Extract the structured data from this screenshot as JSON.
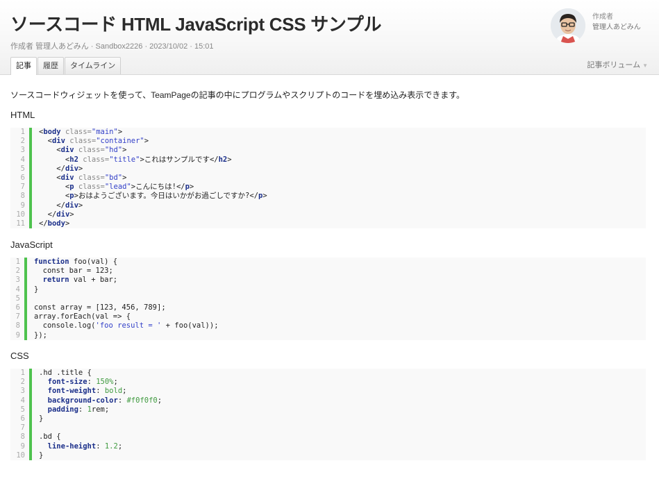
{
  "page": {
    "title": "ソースコード HTML JavaScript CSS サンプル",
    "meta": "作成者 管理人あどみん · Sandbox2226 · 2023/10/02 · 15:01",
    "author_label": "作成者",
    "author_name": "管理人あどみん",
    "tabs": [
      {
        "label": "記事",
        "active": true
      },
      {
        "label": "履歴",
        "active": false
      },
      {
        "label": "タイムライン",
        "active": false
      }
    ],
    "volume_menu": "記事ボリューム"
  },
  "content": {
    "intro": "ソースコードウィジェットを使って、TeamPageの記事の中にプログラムやスクリプトのコードを埋め込み表示できます。",
    "sections": [
      {
        "label": "HTML",
        "lines": [
          [
            {
              "c": "p",
              "t": "<"
            },
            {
              "c": "t",
              "t": "body"
            },
            {
              "c": "a",
              "t": " class="
            },
            {
              "c": "s",
              "t": "\"main\""
            },
            {
              "c": "p",
              "t": ">"
            }
          ],
          [
            {
              "c": "p",
              "t": "  <"
            },
            {
              "c": "t",
              "t": "div"
            },
            {
              "c": "a",
              "t": " class="
            },
            {
              "c": "s",
              "t": "\"container\""
            },
            {
              "c": "p",
              "t": ">"
            }
          ],
          [
            {
              "c": "p",
              "t": "    <"
            },
            {
              "c": "t",
              "t": "div"
            },
            {
              "c": "a",
              "t": " class="
            },
            {
              "c": "s",
              "t": "\"hd\""
            },
            {
              "c": "p",
              "t": ">"
            }
          ],
          [
            {
              "c": "p",
              "t": "      <"
            },
            {
              "c": "t",
              "t": "h2"
            },
            {
              "c": "a",
              "t": " class="
            },
            {
              "c": "s",
              "t": "\"title\""
            },
            {
              "c": "p",
              "t": ">これはサンプルです</"
            },
            {
              "c": "t",
              "t": "h2"
            },
            {
              "c": "p",
              "t": ">"
            }
          ],
          [
            {
              "c": "p",
              "t": "    </"
            },
            {
              "c": "t",
              "t": "div"
            },
            {
              "c": "p",
              "t": ">"
            }
          ],
          [
            {
              "c": "p",
              "t": "    <"
            },
            {
              "c": "t",
              "t": "div"
            },
            {
              "c": "a",
              "t": " class="
            },
            {
              "c": "s",
              "t": "\"bd\""
            },
            {
              "c": "p",
              "t": ">"
            }
          ],
          [
            {
              "c": "p",
              "t": "      <"
            },
            {
              "c": "t",
              "t": "p"
            },
            {
              "c": "a",
              "t": " class="
            },
            {
              "c": "s",
              "t": "\"lead\""
            },
            {
              "c": "p",
              "t": ">こんにちは!</"
            },
            {
              "c": "t",
              "t": "p"
            },
            {
              "c": "p",
              "t": ">"
            }
          ],
          [
            {
              "c": "p",
              "t": "      <"
            },
            {
              "c": "t",
              "t": "p"
            },
            {
              "c": "p",
              "t": ">おはようございます。今日はいかがお過ごしですか?</"
            },
            {
              "c": "t",
              "t": "p"
            },
            {
              "c": "p",
              "t": ">"
            }
          ],
          [
            {
              "c": "p",
              "t": "    </"
            },
            {
              "c": "t",
              "t": "div"
            },
            {
              "c": "p",
              "t": ">"
            }
          ],
          [
            {
              "c": "p",
              "t": "  </"
            },
            {
              "c": "t",
              "t": "div"
            },
            {
              "c": "p",
              "t": ">"
            }
          ],
          [
            {
              "c": "p",
              "t": "</"
            },
            {
              "c": "t",
              "t": "body"
            },
            {
              "c": "p",
              "t": ">"
            }
          ]
        ]
      },
      {
        "label": "JavaScript",
        "lines": [
          [
            {
              "c": "k",
              "t": "function"
            },
            {
              "c": "p",
              "t": " foo(val) {"
            }
          ],
          [
            {
              "c": "p",
              "t": "  const bar = 123;"
            }
          ],
          [
            {
              "c": "p",
              "t": "  "
            },
            {
              "c": "k",
              "t": "return"
            },
            {
              "c": "p",
              "t": " val + bar;"
            }
          ],
          [
            {
              "c": "p",
              "t": "}"
            }
          ],
          [
            {
              "c": "p",
              "t": ""
            }
          ],
          [
            {
              "c": "p",
              "t": "const array = [123, 456, 789];"
            }
          ],
          [
            {
              "c": "p",
              "t": "array.forEach(val => {"
            }
          ],
          [
            {
              "c": "p",
              "t": "  console.log("
            },
            {
              "c": "s",
              "t": "'foo result = '"
            },
            {
              "c": "p",
              "t": " + foo(val));"
            }
          ],
          [
            {
              "c": "p",
              "t": "});"
            }
          ]
        ]
      },
      {
        "label": "CSS",
        "lines": [
          [
            {
              "c": "p",
              "t": ".hd .title {"
            }
          ],
          [
            {
              "c": "p",
              "t": "  "
            },
            {
              "c": "prop",
              "t": "font-size"
            },
            {
              "c": "p",
              "t": ": "
            },
            {
              "c": "val",
              "t": "150%"
            },
            {
              "c": "p",
              "t": ";"
            }
          ],
          [
            {
              "c": "p",
              "t": "  "
            },
            {
              "c": "prop",
              "t": "font-weight"
            },
            {
              "c": "p",
              "t": ": "
            },
            {
              "c": "val",
              "t": "bold"
            },
            {
              "c": "p",
              "t": ";"
            }
          ],
          [
            {
              "c": "p",
              "t": "  "
            },
            {
              "c": "prop",
              "t": "background-color"
            },
            {
              "c": "p",
              "t": ": "
            },
            {
              "c": "val",
              "t": "#f0f0f0"
            },
            {
              "c": "p",
              "t": ";"
            }
          ],
          [
            {
              "c": "p",
              "t": "  "
            },
            {
              "c": "prop",
              "t": "padding"
            },
            {
              "c": "p",
              "t": ": "
            },
            {
              "c": "val",
              "t": "1"
            },
            {
              "c": "p",
              "t": "rem;"
            }
          ],
          [
            {
              "c": "p",
              "t": "}"
            }
          ],
          [
            {
              "c": "p",
              "t": ""
            }
          ],
          [
            {
              "c": "p",
              "t": ".bd {"
            }
          ],
          [
            {
              "c": "p",
              "t": "  "
            },
            {
              "c": "prop",
              "t": "line-height"
            },
            {
              "c": "p",
              "t": ": "
            },
            {
              "c": "val",
              "t": "1.2"
            },
            {
              "c": "p",
              "t": ";"
            }
          ],
          [
            {
              "c": "p",
              "t": "}"
            }
          ]
        ]
      }
    ]
  },
  "colors": {
    "gutter_bar": "#4ec24e",
    "code_bg": "#f9f9f9",
    "keyword": "#1b2f8a",
    "string": "#3340c8",
    "css_value": "#3f9a3f",
    "attribute": "#888888"
  }
}
